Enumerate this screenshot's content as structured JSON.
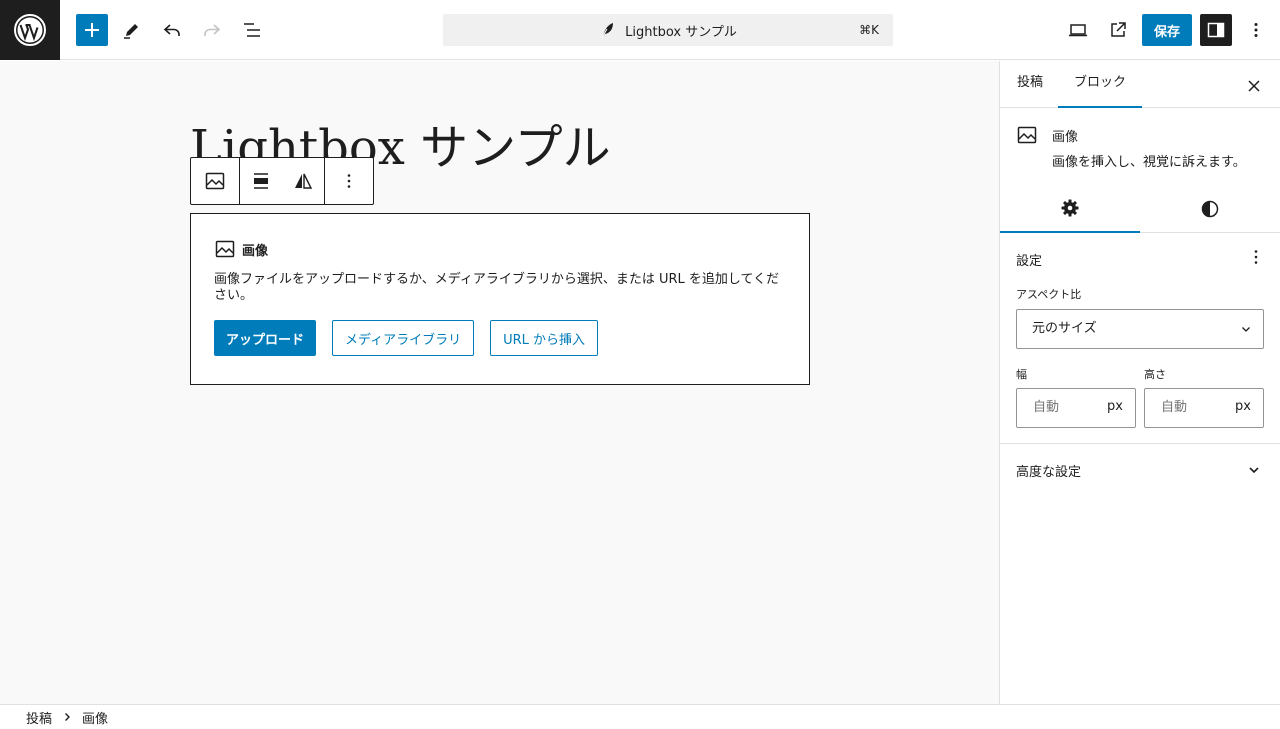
{
  "toolbar": {
    "document_title": "Lightbox サンプル",
    "shortcut": "⌘K",
    "save_label": "保存"
  },
  "editor": {
    "post_title": "Lightbox サンプル",
    "placeholder": {
      "label": "画像",
      "instructions": "画像ファイルをアップロードするか、メディアライブラリから選択、または URL を追加してください。",
      "upload_label": "アップロード",
      "media_library_label": "メディアライブラリ",
      "insert_url_label": "URL から挿入"
    }
  },
  "sidebar": {
    "tabs": [
      {
        "label": "投稿",
        "active": false
      },
      {
        "label": "ブロック",
        "active": true
      }
    ],
    "block": {
      "title": "画像",
      "description": "画像を挿入し、視覚に訴えます。"
    },
    "settings_panel": {
      "title": "設定",
      "aspect_ratio_label": "アスペクト比",
      "aspect_ratio_value": "元のサイズ",
      "width_label": "幅",
      "width_placeholder": "自動",
      "width_unit": "px",
      "height_label": "高さ",
      "height_placeholder": "自動",
      "height_unit": "px"
    },
    "advanced_panel": {
      "title": "高度な設定"
    }
  },
  "breadcrumb": {
    "items": [
      "投稿",
      "画像"
    ]
  },
  "colors": {
    "accent": "#007cba",
    "dark": "#1e1e1e",
    "canvas_bg": "#f9f9f9"
  }
}
